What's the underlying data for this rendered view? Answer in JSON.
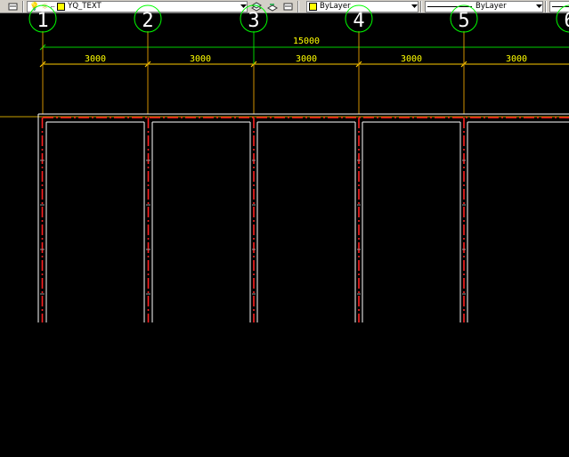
{
  "toolbar": {
    "layer_name": "YQ_TEXT",
    "color_value": "ByLayer",
    "linetype_value": "ByLayer"
  },
  "drawing": {
    "grid_axes": [
      "1",
      "2",
      "3",
      "4",
      "5",
      "6"
    ],
    "total_dimension": "15000",
    "bay_dimensions": [
      "3000",
      "3000",
      "3000",
      "3000",
      "3000"
    ]
  },
  "colors": {
    "background": "#000000",
    "axis_circle": "#00ff00",
    "axis_label": "#ffffff",
    "dimension_text": "#ffff00",
    "dimension_line_total": "#00ff00",
    "dimension_line_bays": "#ffff00",
    "axis_lines": "#ffa500",
    "wall_outline": "#ffffff",
    "wall_hatch": "#ff0000",
    "layer_swatch": "#ffff00"
  }
}
